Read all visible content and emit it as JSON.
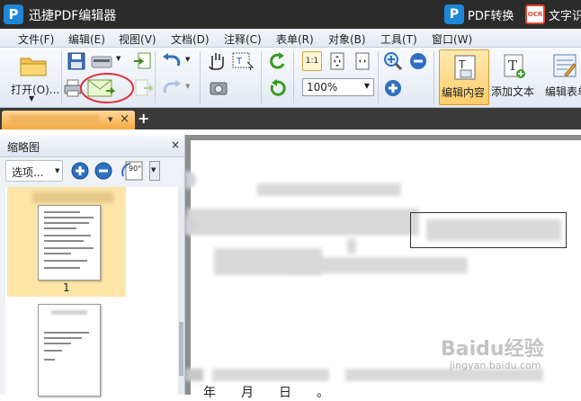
{
  "titlebar": {
    "app_logo": "P",
    "title": "迅捷PDF编辑器",
    "pdf_convert": {
      "icon_text": "P",
      "label": "PDF转换"
    },
    "ocr": {
      "icon_text": "OCR",
      "label": "文字识"
    }
  },
  "menu": [
    "文件(F)",
    "编辑(E)",
    "视图(V)",
    "文档(D)",
    "注释(C)",
    "表单(R)",
    "对象(B)",
    "工具(T)",
    "窗口(W)"
  ],
  "toolbar": {
    "open_label": "打开(O)...",
    "zoom_value": "100%",
    "fit_page_text": "1:1",
    "edit_content_label": "编辑内容",
    "add_text_label": "添加文本",
    "edit_form_label": "编辑表单"
  },
  "tabs": {
    "close": "×",
    "new": "+"
  },
  "thumbnail_panel": {
    "title": "缩略图",
    "close": "×",
    "options_label": "选项...",
    "rotate_label": "90°",
    "pages": [
      {
        "number": "1"
      }
    ]
  },
  "document": {
    "bottom_text": "年月日。"
  },
  "watermark": {
    "text": "Baidu经验",
    "sub": "jingyan.baidu.com"
  },
  "colors": {
    "titlebar": "#2b2b2b",
    "accent": "#1e88d8",
    "active_tab": "#f5a93e",
    "highlight_circle": "#e0303b"
  }
}
